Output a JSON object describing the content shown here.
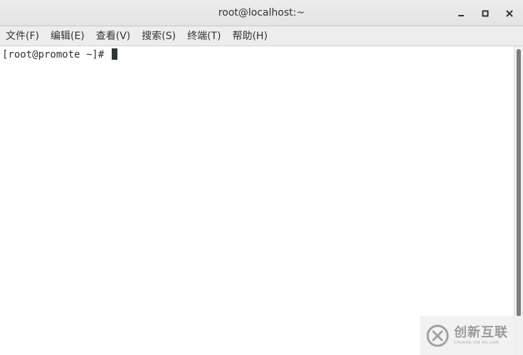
{
  "window": {
    "title": "root@localhost:~"
  },
  "controls": {
    "minimize_icon": "minimize-icon",
    "maximize_icon": "maximize-icon",
    "close_icon": "close-icon"
  },
  "menubar": {
    "items": [
      {
        "label": "文件(F)"
      },
      {
        "label": "编辑(E)"
      },
      {
        "label": "查看(V)"
      },
      {
        "label": "搜索(S)"
      },
      {
        "label": "终端(T)"
      },
      {
        "label": "帮助(H)"
      }
    ]
  },
  "terminal": {
    "prompt": "[root@promote ~]# "
  },
  "watermark": {
    "name": "创新互联",
    "subtitle": "CHUANG XIN HU LIAN"
  },
  "colors": {
    "titlebar_bg": "#e8e8e8",
    "menubar_bg": "#ededed",
    "terminal_bg": "#ffffff",
    "text": "#2e3436",
    "scroll_thumb": "#7a7e80"
  }
}
